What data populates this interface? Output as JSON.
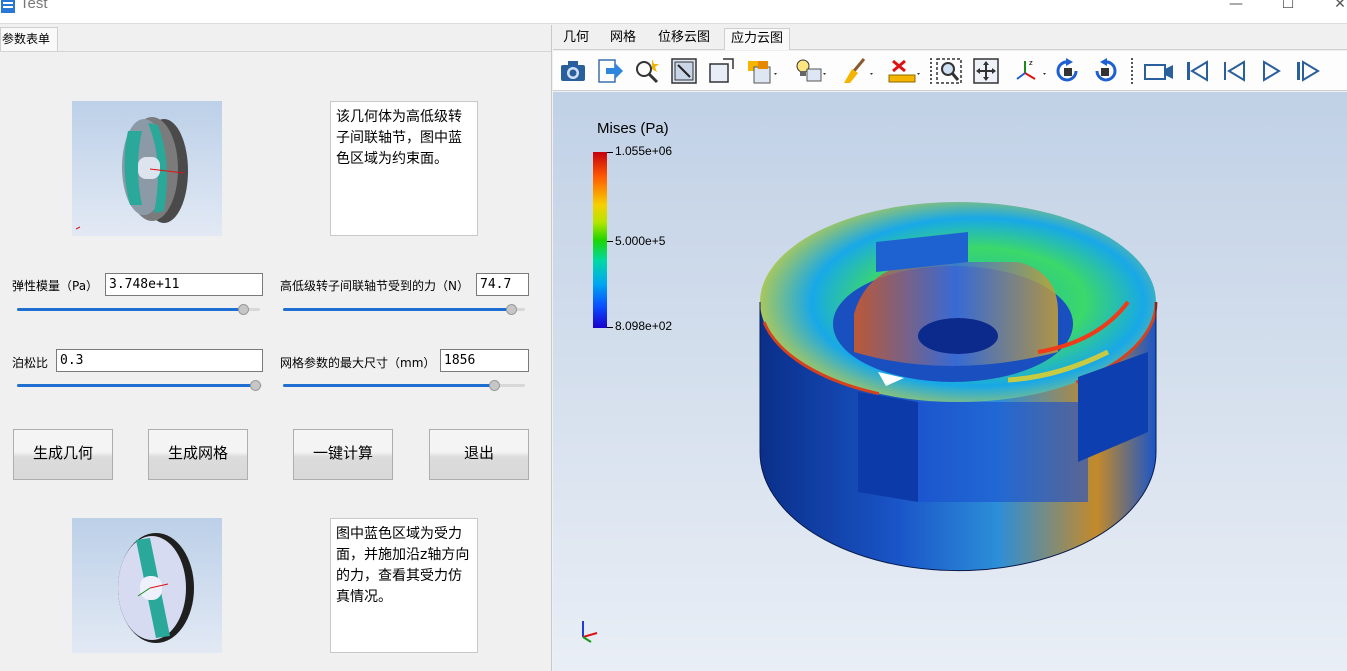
{
  "window": {
    "title": "Test",
    "minimize": "—",
    "maximize": "☐",
    "close": "✕"
  },
  "left_panel": {
    "tab_label": "参数表单",
    "top_note": "该几何体为高低级转子间联轴节，图中蓝色区域为约束面。",
    "bottom_note": "图中蓝色区域为受力面，并施加沿z轴方向的力，查看其受力仿真情况。",
    "params": {
      "elastic_modulus": {
        "label": "弹性模量（Pa）",
        "value": "3.748e+11",
        "slider_fraction": 0.94
      },
      "force": {
        "label": "高低级转子间联轴节受到的力（N）",
        "value": "74.7",
        "slider_fraction": 0.95
      },
      "poisson": {
        "label": "泊松比",
        "value": "0.3",
        "slider_fraction": 1.0
      },
      "mesh_size": {
        "label": "网格参数的最大尺寸（mm）",
        "value": "1856",
        "slider_fraction": 0.87
      }
    },
    "buttons": {
      "gen_geometry": "生成几何",
      "gen_mesh": "生成网格",
      "compute": "一键计算",
      "exit": "退出"
    }
  },
  "right_panel": {
    "tabs": [
      "几何",
      "网格",
      "位移云图",
      "应力云图"
    ],
    "active_tab": "应力云图",
    "toolbar_icons": [
      "camera-icon",
      "export-icon",
      "magic-wand-icon",
      "fit-view-icon",
      "box-select-icon",
      "folder-open-icon",
      "bulb-icon",
      "brush-icon",
      "ruler-clear-icon",
      "zoom-box-icon",
      "pan-icon",
      "axes-icon",
      "rotate-cw-icon",
      "rotate-ccw-icon",
      "record-video-icon",
      "first-frame-icon",
      "prev-frame-icon",
      "play-icon",
      "last-frame-icon"
    ],
    "legend": {
      "title": "Mises (Pa)",
      "max": "1.055e+06",
      "mid": "5.000e+5",
      "min": "8.098e+02"
    }
  }
}
